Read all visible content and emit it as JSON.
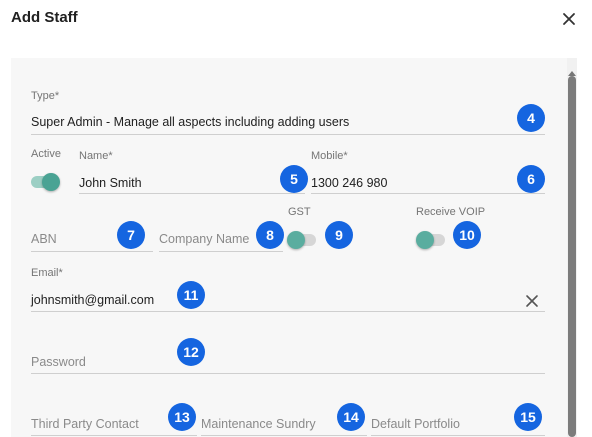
{
  "dialog": {
    "title": "Add Staff",
    "close_icon": "close-icon"
  },
  "form": {
    "type": {
      "label": "Type*",
      "value": "Super Admin - Manage all aspects including adding users"
    },
    "active": {
      "label": "Active",
      "on": true
    },
    "name": {
      "label": "Name*",
      "value": "John Smith"
    },
    "mobile": {
      "label": "Mobile*",
      "value": "1300 246 980"
    },
    "abn": {
      "placeholder": "ABN"
    },
    "company_name": {
      "placeholder": "Company Name"
    },
    "gst": {
      "label": "GST",
      "on": false
    },
    "receive_voip": {
      "label": "Receive VOIP",
      "on": false
    },
    "email": {
      "label": "Email*",
      "value": "johnsmith@gmail.com",
      "clear_icon": "clear-icon"
    },
    "password": {
      "placeholder": "Password"
    },
    "third_party_contact": {
      "placeholder": "Third Party Contact"
    },
    "maintenance_sundry": {
      "placeholder": "Maintenance Sundry"
    },
    "default_portfolio": {
      "placeholder": "Default Portfolio"
    }
  },
  "badges": [
    "4",
    "5",
    "6",
    "7",
    "8",
    "9",
    "10",
    "11",
    "12",
    "13",
    "14",
    "15"
  ],
  "colors": {
    "accent": "#4aa394",
    "badge": "#1565e0",
    "panel_background": "#f7f7f7",
    "scrollbar_thumb": "#7c7c7c"
  }
}
